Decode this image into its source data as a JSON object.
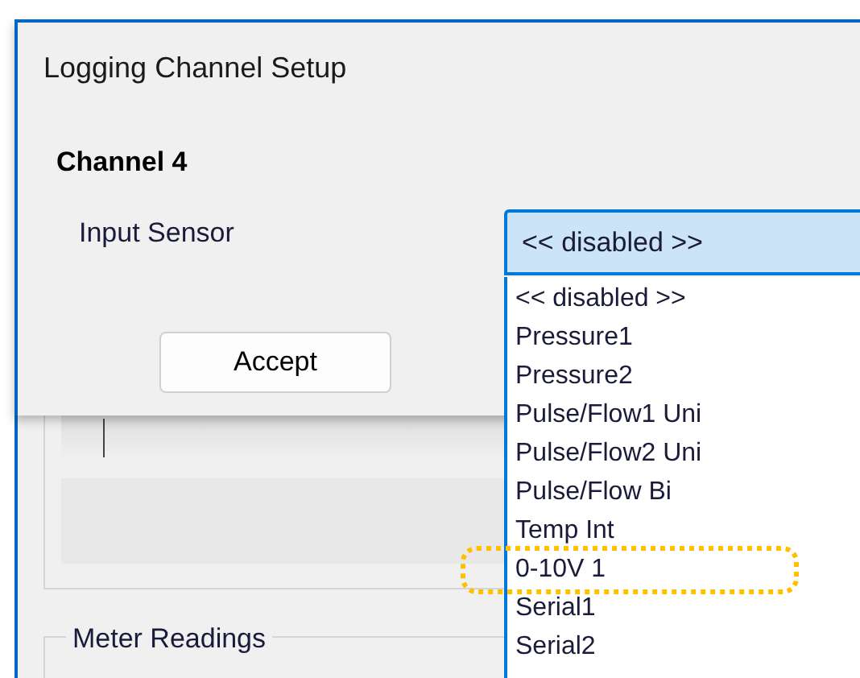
{
  "dialog": {
    "title": "Logging Channel Setup",
    "heading": "Channel 4",
    "field_label": "Input Sensor",
    "combo_value": "<< disabled >>",
    "accept_button": "Accept"
  },
  "dropdown": {
    "items": [
      {
        "label": "<< disabled >>",
        "selected": false
      },
      {
        "label": "Pressure1",
        "selected": false
      },
      {
        "label": "Pressure2",
        "selected": false
      },
      {
        "label": "Pulse/Flow1 Uni",
        "selected": false
      },
      {
        "label": "Pulse/Flow2 Uni",
        "selected": false
      },
      {
        "label": "Pulse/Flow Bi",
        "selected": false
      },
      {
        "label": "Temp Int",
        "selected": false
      },
      {
        "label": "0-10V 1",
        "selected": false
      },
      {
        "label": "Serial1",
        "selected": false
      },
      {
        "label": "Serial2",
        "selected": false
      }
    ]
  },
  "background_form": {
    "group_title": "Meter Readings"
  }
}
